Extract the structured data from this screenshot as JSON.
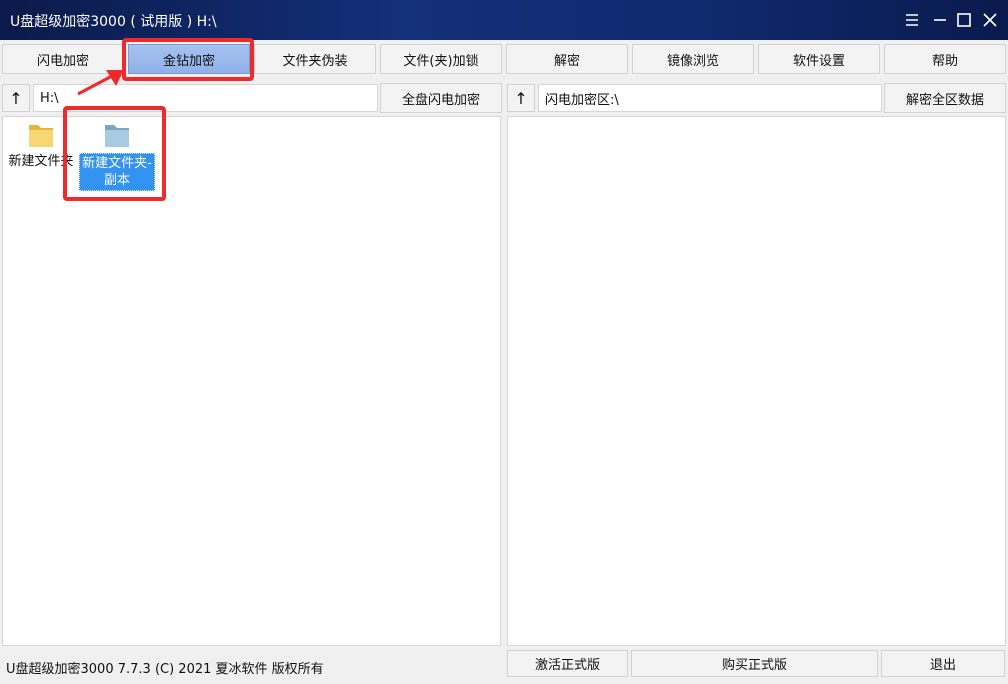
{
  "window": {
    "title": "U盘超级加密3000 ( 试用版 )  H:\\"
  },
  "toolbar": {
    "buttons": [
      "闪电加密",
      "金钻加密",
      "文件夹伪装",
      "文件(夹)加锁",
      "解密",
      "镜像浏览",
      "软件设置",
      "帮助"
    ],
    "active": "金钻加密"
  },
  "left_panel": {
    "up_symbol": "↑",
    "path": "H:\\",
    "action": "全盘闪电加密",
    "files": [
      {
        "name": "新建文件夹",
        "selected": false
      },
      {
        "name": "新建文件夹-副本",
        "selected": true
      }
    ]
  },
  "right_panel": {
    "up_symbol": "↑",
    "path": "闪电加密区:\\",
    "action": "解密全区数据"
  },
  "status": {
    "text": "U盘超级加密3000  7.7.3  (C) 2021 夏冰软件 版权所有"
  },
  "footer_buttons": [
    "激活正式版",
    "购买正式版",
    "退出"
  ],
  "colors": {
    "title_bg": "#13307a",
    "active_button": "#9bb8ec",
    "highlight": "#f02a2a",
    "selection": "#3393f0"
  }
}
